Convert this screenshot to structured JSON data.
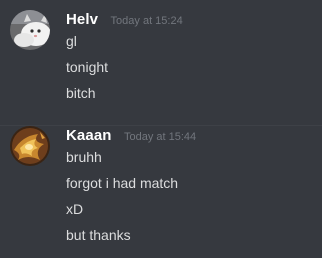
{
  "messages": [
    {
      "author": "Helv",
      "timestamp": "Today at 15:24",
      "avatar": "cat-photo-avatar",
      "lines": [
        "gl",
        "tonight",
        "bitch"
      ]
    },
    {
      "author": "Kaaan",
      "timestamp": "Today at 15:44",
      "avatar": "fantasy-character-avatar",
      "lines": [
        "bruhh",
        "forgot i had match",
        "xD",
        "but thanks"
      ]
    }
  ],
  "colors": {
    "background": "#36393f",
    "divider": "#3e4147",
    "username": "#ffffff",
    "timestamp": "#72767d",
    "message_text": "#dcddde"
  }
}
